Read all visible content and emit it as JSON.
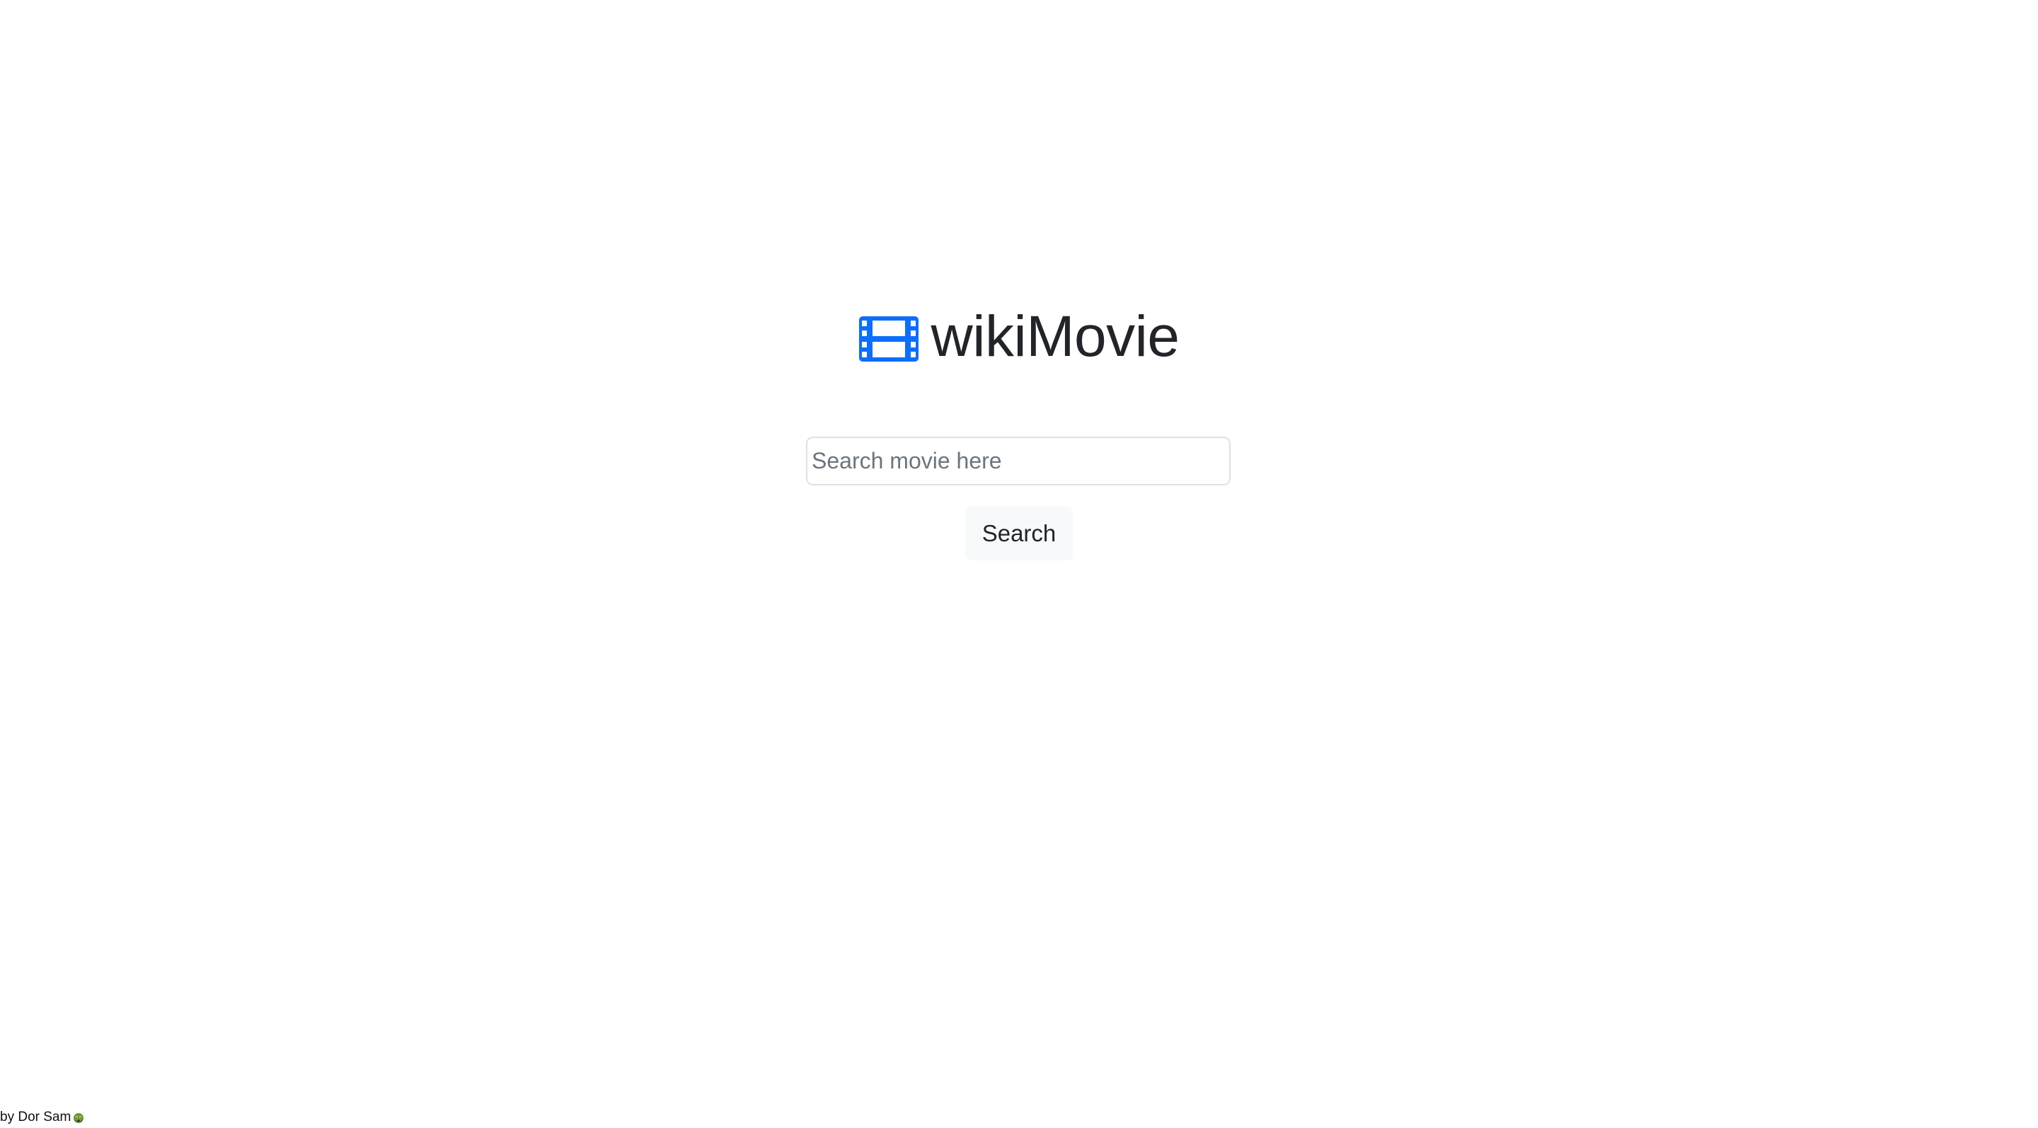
{
  "brand": {
    "title": "wikiMovie",
    "icon": "film-icon",
    "icon_color": "#0d6efd"
  },
  "search": {
    "placeholder": "Search movie here",
    "value": "",
    "button_label": "Search"
  },
  "footer": {
    "credit": "by Dor Sam",
    "emoji_icon": "ogre-icon"
  }
}
